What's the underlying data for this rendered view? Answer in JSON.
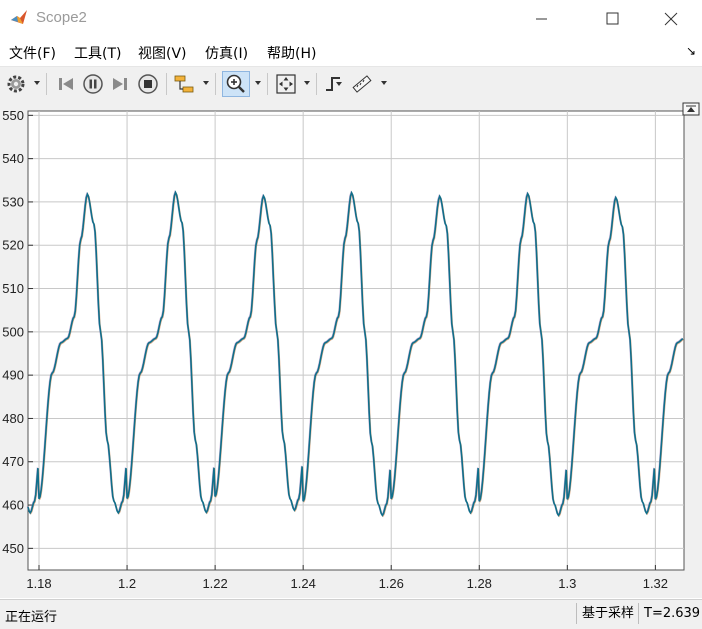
{
  "window": {
    "title": "Scope2",
    "icon": "matlab-logo-icon",
    "controls": [
      "minimize-icon",
      "maximize-icon",
      "close-icon"
    ]
  },
  "menu": {
    "items": [
      "文件(F)",
      "工具(T)",
      "视图(V)",
      "仿真(I)",
      "帮助(H)"
    ],
    "corner_glyph": "↘"
  },
  "toolbar": {
    "buttons": [
      "settings-icon",
      "step-back-icon",
      "pause-icon",
      "step-forward-icon",
      "stop-icon",
      "signal-highlight-icon",
      "zoom-in-icon",
      "autoscale-icon",
      "triggers-icon",
      "measurements-icon"
    ],
    "active": "zoom-in-icon"
  },
  "status": {
    "left": "正在运行",
    "mode": "基于采样",
    "time": "T=2.639"
  },
  "chart_data": {
    "type": "line",
    "title": "",
    "xlabel": "",
    "ylabel": "",
    "xlim": [
      1.1775,
      1.3265
    ],
    "ylim": [
      445,
      551
    ],
    "grid": true,
    "background": "#ffffff",
    "line_color": "#0f6f8a",
    "x_ticks": [
      1.18,
      1.2,
      1.22,
      1.24,
      1.26,
      1.28,
      1.3,
      1.32
    ],
    "x_tick_labels": [
      "1.18",
      "1.2",
      "1.22",
      "1.24",
      "1.26",
      "1.28",
      "1.3",
      "1.32"
    ],
    "y_ticks": [
      450,
      460,
      470,
      480,
      490,
      500,
      510,
      520,
      530,
      540,
      550
    ],
    "y_tick_labels": [
      "450",
      "460",
      "470",
      "480",
      "490",
      "500",
      "510",
      "520",
      "530",
      "540",
      "550"
    ],
    "series": [
      {
        "period": 0.02,
        "points": [
          [
            0,
            461.5
          ],
          [
            0.003,
            490.5
          ],
          [
            0.005,
            497.5
          ],
          [
            0.0065,
            498.5
          ],
          [
            0.008,
            503.5
          ],
          [
            0.0095,
            521.5
          ],
          [
            0.011,
            532
          ],
          [
            0.0125,
            525
          ],
          [
            0.014,
            500
          ],
          [
            0.0155,
            475
          ],
          [
            0.017,
            461
          ],
          [
            0.018,
            458.3
          ],
          [
            0.019,
            461
          ],
          [
            0.02,
            470
          ]
        ],
        "peaks": [
          531.8,
          532.2,
          531.4,
          532.1,
          531.3,
          531.9,
          531.0
        ],
        "troughs": [
          458.2,
          458.3,
          458.8,
          457.6,
          458.2,
          457.6,
          458.1
        ]
      }
    ]
  }
}
